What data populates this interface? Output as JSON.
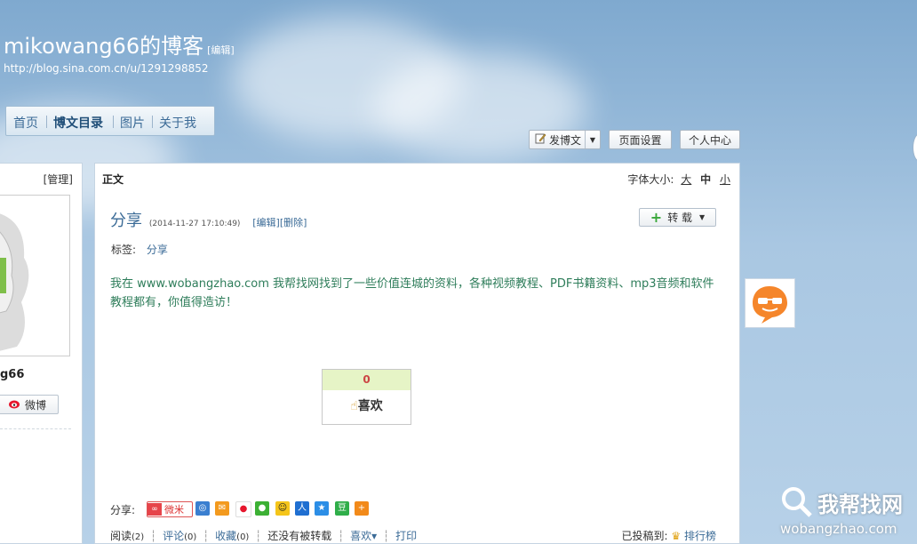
{
  "blog": {
    "title": "mikowang66的博客",
    "edit_label": "[编辑]",
    "url": "http://blog.sina.com.cn/u/1291298852"
  },
  "nav": {
    "items": [
      {
        "label": "首页"
      },
      {
        "label": "博文目录"
      },
      {
        "label": "图片"
      },
      {
        "label": "关于我"
      }
    ]
  },
  "toolbar": {
    "post_label": "发博文",
    "page_settings_label": "页面设置",
    "personal_center_label": "个人中心"
  },
  "left_panel": {
    "manage_label": "[管理]",
    "username_fragment": "g66",
    "weibo_label": "微博"
  },
  "main": {
    "section_title": "正文",
    "font_size_label": "字体大小:",
    "font_sizes": {
      "large": "大",
      "medium": "中",
      "small": "小"
    },
    "post": {
      "title": "分享",
      "timestamp": "(2014-11-27 17:10:49)",
      "edit_link": "[编辑]",
      "delete_link": "[删除]",
      "reprint_label": "转 载",
      "tags_label": "标签:",
      "tag": "分享",
      "body": "我在 www.wobangzhao.com 我帮找网找到了一些价值连城的资料，各种视频教程、PDF书籍资料、mp3音频和软件教程都有，你值得造访！"
    },
    "like": {
      "count": "0",
      "label": "喜欢"
    },
    "share": {
      "label": "分享:",
      "weimi_label": "微米"
    },
    "footer": {
      "read": "阅读",
      "read_count": "(2)",
      "comment": "评论",
      "comment_count": "(0)",
      "favorite": "收藏",
      "favorite_count": "(0)",
      "not_reprinted": "还没有被转载",
      "like": "喜欢▾",
      "print": "打印",
      "submitted_to": "已投稿到:",
      "rank": "排行榜"
    }
  },
  "watermark": {
    "name": "我帮找网",
    "domain": "wobangzhao.com"
  },
  "colors": {
    "link": "#3b6b97",
    "post_text": "#2e7d5a",
    "like_bg": "#e6f4c6"
  }
}
